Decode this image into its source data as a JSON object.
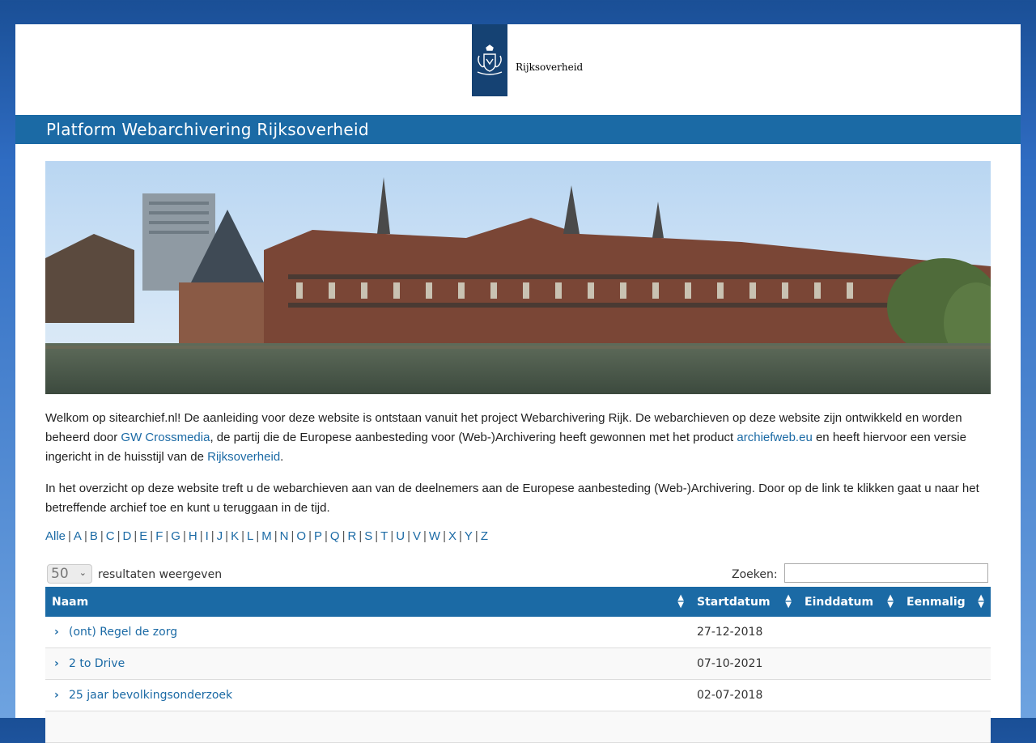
{
  "header": {
    "logo_text": "Rijksoverheid",
    "site_title": "Platform Webarchivering Rijksoverheid"
  },
  "intro": {
    "p1_part1": "Welkom op sitearchief.nl! De aanleiding voor deze website is ontstaan vanuit het project Webarchivering Rijk. De webarchieven op deze website zijn ontwikkeld en worden beheerd door ",
    "p1_link1": "GW Crossmedia",
    "p1_part2": ", de partij die de Europese aanbesteding voor (Web-)Archivering heeft gewonnen met het product ",
    "p1_link2": "archiefweb.eu",
    "p1_part3": " en heeft hiervoor een versie ingericht in de huisstijl van de ",
    "p1_link3": "Rijksoverheid",
    "p1_part4": ".",
    "p2": "In het overzicht op deze website treft u de webarchieven aan van de deelnemers aan de Europese aanbesteding (Web-)Archivering. Door op de link te klikken gaat u naar het betreffende archief toe en kunt u teruggaan in de tijd."
  },
  "alphabet": [
    "Alle",
    "A",
    "B",
    "C",
    "D",
    "E",
    "F",
    "G",
    "H",
    "I",
    "J",
    "K",
    "L",
    "M",
    "N",
    "O",
    "P",
    "Q",
    "R",
    "S",
    "T",
    "U",
    "V",
    "W",
    "X",
    "Y",
    "Z"
  ],
  "controls": {
    "page_length": "50",
    "page_length_label": "resultaten weergeven",
    "search_label": "Zoeken:",
    "search_value": ""
  },
  "table": {
    "columns": [
      "Naam",
      "Startdatum",
      "Einddatum",
      "Eenmalig"
    ],
    "rows": [
      {
        "name": "(ont) Regel de zorg",
        "start": "27-12-2018",
        "end": "",
        "once": ""
      },
      {
        "name": "2 to Drive",
        "start": "07-10-2021",
        "end": "",
        "once": ""
      },
      {
        "name": "25 jaar bevolkingsonderzoek",
        "start": "02-07-2018",
        "end": "",
        "once": ""
      }
    ]
  },
  "colors": {
    "title_bar": "#1b6aa5",
    "logo_blue": "#154273",
    "link": "#1b6aa5"
  }
}
